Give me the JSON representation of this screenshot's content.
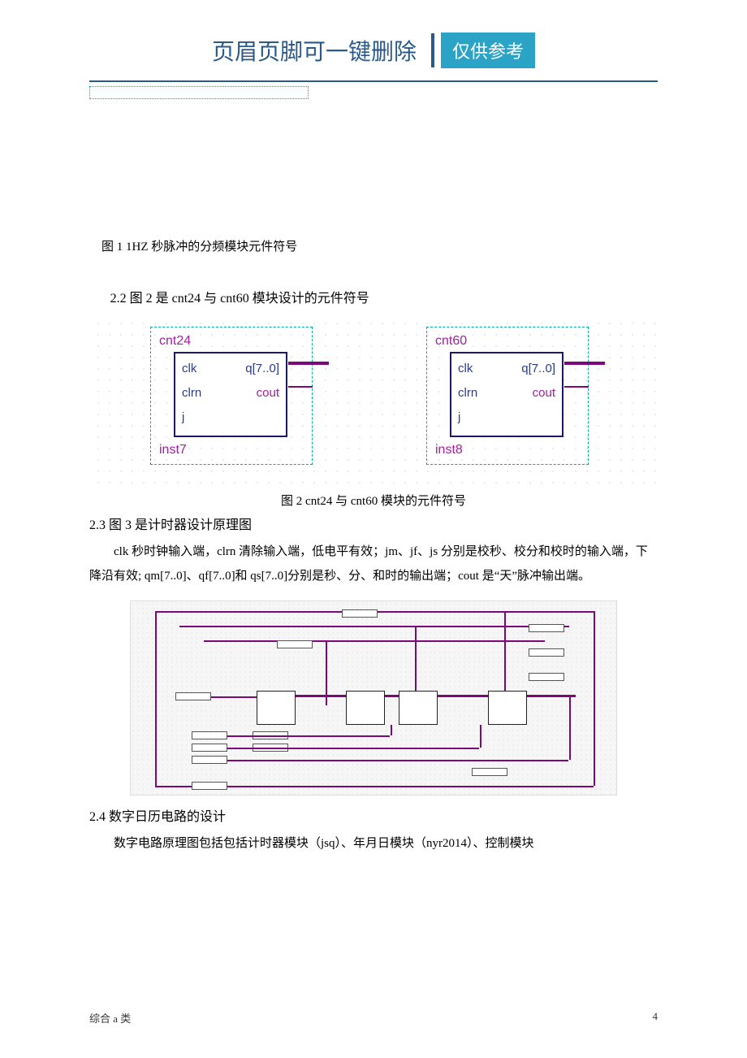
{
  "header": {
    "title": "页眉页脚可一键删除",
    "badge": "仅供参考"
  },
  "caption1": "图 1 1HZ 秒脉冲的分频模块元件符号",
  "section22": "2.2 图 2 是 cnt24 与 cnt60 模块设计的元件符号",
  "module1": {
    "name": "cnt24",
    "inst": "inst7",
    "clk": "clk",
    "clrn": "clrn",
    "j": "j",
    "q": "q[7..0]",
    "cout": "cout"
  },
  "module2": {
    "name": "cnt60",
    "inst": "inst8",
    "clk": "clk",
    "clrn": "clrn",
    "j": "j",
    "q": "q[7..0]",
    "cout": "cout"
  },
  "caption2": "图 2  cnt24 与 cnt60 模块的元件符号",
  "section23": "2.3 图 3 是计时器设计原理图",
  "body23": "clk 秒时钟输入端，clrn 清除输入端，低电平有效；jm、jf、js 分别是校秒、校分和校时的输入端，下降沿有效; qm[7..0]、qf[7..0]和 qs[7..0]分别是秒、分、和时的输出端；cout 是“天”脉冲输出端。",
  "section24": "2.4 数字日历电路的设计",
  "body24": "数字电路原理图包括包括计时器模块（jsq）、年月日模块（nyr2014）、控制模块",
  "footer": {
    "left": "综合 a 类",
    "right": "4"
  }
}
